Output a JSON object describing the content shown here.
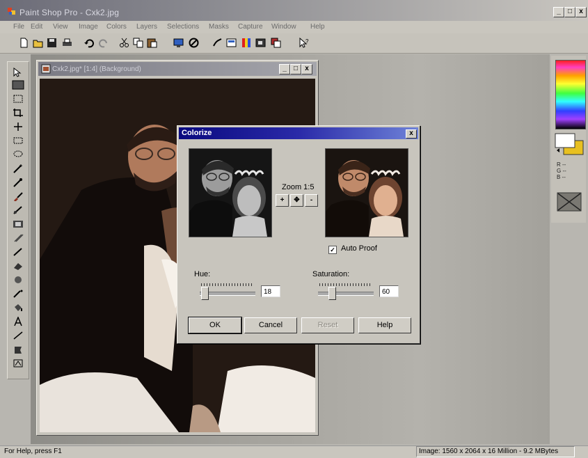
{
  "window": {
    "title": "Paint Shop Pro - Cxk2.jpg",
    "minimize_glyph": "_",
    "maximize_glyph": "□",
    "close_glyph": "x"
  },
  "menu": [
    "File",
    "Edit",
    "View",
    "Image",
    "Colors",
    "Layers",
    "Selections",
    "Masks",
    "Capture",
    "Window",
    "Help"
  ],
  "image_window": {
    "title": "Cxk2.jpg* [1:4] (Background)",
    "minimize_glyph": "_",
    "maximize_glyph": "□",
    "close_glyph": "x"
  },
  "rgb_readout": [
    "R --",
    "G --",
    "B --"
  ],
  "dialog": {
    "title": "Colorize",
    "close_glyph": "x",
    "zoom_label": "Zoom 1:5",
    "zoom_in_glyph": "+",
    "pan_glyph": "✥",
    "zoom_out_glyph": "-",
    "auto_proof_label": "Auto Proof",
    "auto_proof_checked": true,
    "hue_label": "Hue:",
    "hue_value": "18",
    "hue_level": 0.08,
    "saturation_label": "Saturation:",
    "saturation_value": "60",
    "saturation_level": 0.24,
    "buttons": {
      "ok": "OK",
      "cancel": "Cancel",
      "reset": "Reset",
      "help": "Help"
    }
  },
  "status": {
    "left": "For Help, press F1",
    "right": "Image:  1560 x 2064 x 16 Million - 9.2 MBytes"
  },
  "colors": {
    "dialog_title": "#0a0a80",
    "fg_swatch": "#ffffff",
    "bg_swatch": "#e8c020"
  }
}
